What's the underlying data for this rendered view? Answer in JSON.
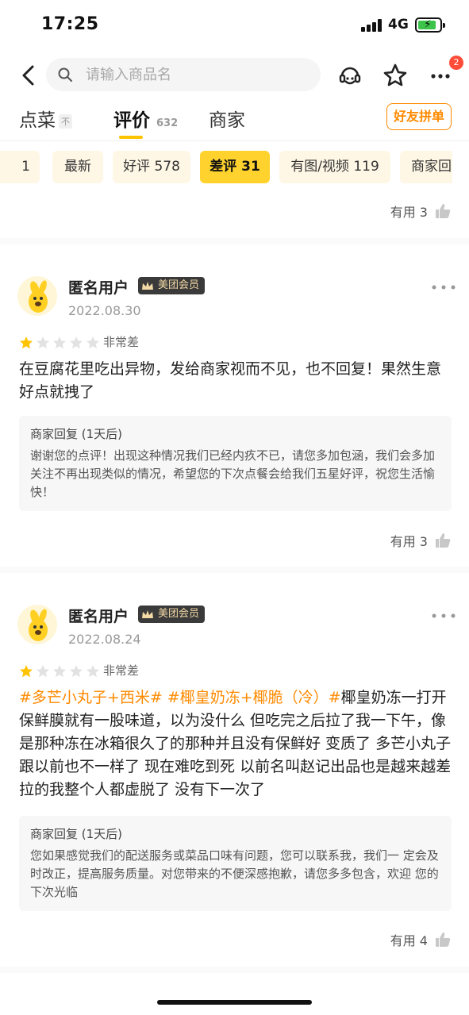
{
  "status_bar": {
    "time": "17:25",
    "network": "4G"
  },
  "search": {
    "placeholder": "请输入商品名"
  },
  "nav": {
    "badge_count": "2"
  },
  "tabs": [
    {
      "label": "点菜",
      "badge": "不"
    },
    {
      "label": "评价",
      "count": "632"
    },
    {
      "label": "商家"
    }
  ],
  "group_button": "好友拼单",
  "filters": [
    {
      "label": "1"
    },
    {
      "label": "最新"
    },
    {
      "label": "好评 578"
    },
    {
      "label": "差评 31"
    },
    {
      "label": "有图/视频 119"
    },
    {
      "label": "商家回"
    }
  ],
  "top_useful": "有用 3",
  "reviews": [
    {
      "user": "匿名用户",
      "member": "美团会员",
      "date": "2022.08.30",
      "stars": 1,
      "rating_label": "非常差",
      "text": "在豆腐花里吃出异物，发给商家视而不见，也不回复！果然生意好点就拽了",
      "reply_title": "商家回复 (1天后)",
      "reply_text": "谢谢您的点评！出现这种情况我们已经内疚不已，请您多加包涵，我们会多加关注不再出现类似的情况，希望您的下次点餐会给我们五星好评，祝您生活愉快！",
      "useful": "有用 3"
    },
    {
      "user": "匿名用户",
      "member": "美团会员",
      "date": "2022.08.24",
      "stars": 1,
      "rating_label": "非常差",
      "tags": "#多芒小丸子+西米# #椰皇奶冻+椰脆（冷）#",
      "text": "椰皇奶冻一打开保鲜膜就有一股味道，以为没什么  但吃完之后拉了我一下午，像是那种冻在冰箱很久了的那种并且没有保鲜好 变质了 多芒小丸子跟以前也不一样了 现在难吃到死 以前名叫赵记出品也是越来越差 拉的我整个人都虚脱了  没有下一次了",
      "reply_title": "商家回复 (1天后)",
      "reply_text": "您如果感觉我们的配送服务或菜品口味有问题，您可以联系我，我们一 定会及时改正，提高服务质量。对您带来的不便深感抱歉，请您多多包含，欢迎 您的下次光临",
      "useful": "有用 4"
    }
  ],
  "colors": {
    "accent": "#ffd22e",
    "orange": "#ff8a00",
    "star": "#ffc300"
  }
}
